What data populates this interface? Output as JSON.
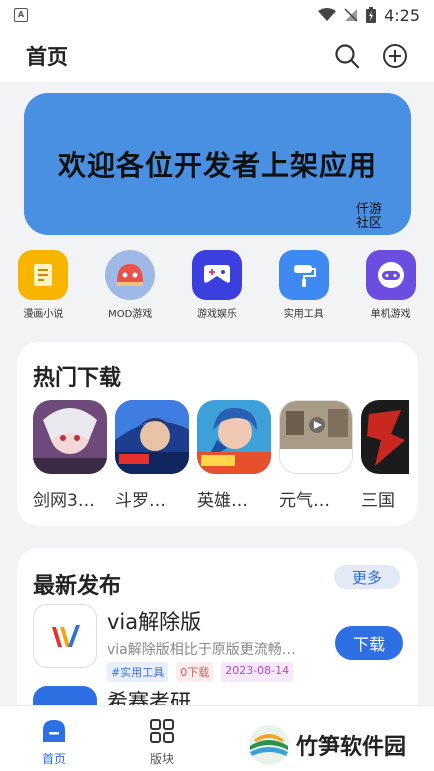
{
  "status_bar": {
    "time": "4:25"
  },
  "header": {
    "title": "首页"
  },
  "banner": {
    "text": "欢迎各位开发者上架应用",
    "stamp": "仟游社区"
  },
  "categories": [
    {
      "label": "漫画小说",
      "color": "#f7b500"
    },
    {
      "label": "MOD游戏",
      "color": "#9fb9e6"
    },
    {
      "label": "游戏娱乐",
      "color": "#3b3fe0"
    },
    {
      "label": "实用工具",
      "color": "#3f8af2"
    },
    {
      "label": "单机游戏",
      "color": "#6b4de0"
    }
  ],
  "hot_downloads": {
    "title": "热门下载",
    "apps": [
      {
        "name": "剑网3…"
      },
      {
        "name": "斗罗…"
      },
      {
        "name": "英雄…"
      },
      {
        "name": "元气…"
      },
      {
        "name": "三国"
      }
    ]
  },
  "latest": {
    "title": "最新发布",
    "more_label": "更多",
    "items": [
      {
        "name": "via解除版",
        "desc": "via解除版相比于原版更流畅…",
        "tags": [
          "#实用工具",
          "0下载",
          "2023-08-14"
        ],
        "download_label": "下载"
      },
      {
        "name": "希赛考研"
      }
    ]
  },
  "bottom_nav": [
    {
      "label": "首页",
      "active": true
    },
    {
      "label": "版块",
      "active": false
    }
  ],
  "watermark": {
    "text": "竹笋软件园"
  },
  "colors": {
    "accent": "#2f6fe4",
    "banner": "#4a90e2",
    "background": "#f2f3f5"
  }
}
